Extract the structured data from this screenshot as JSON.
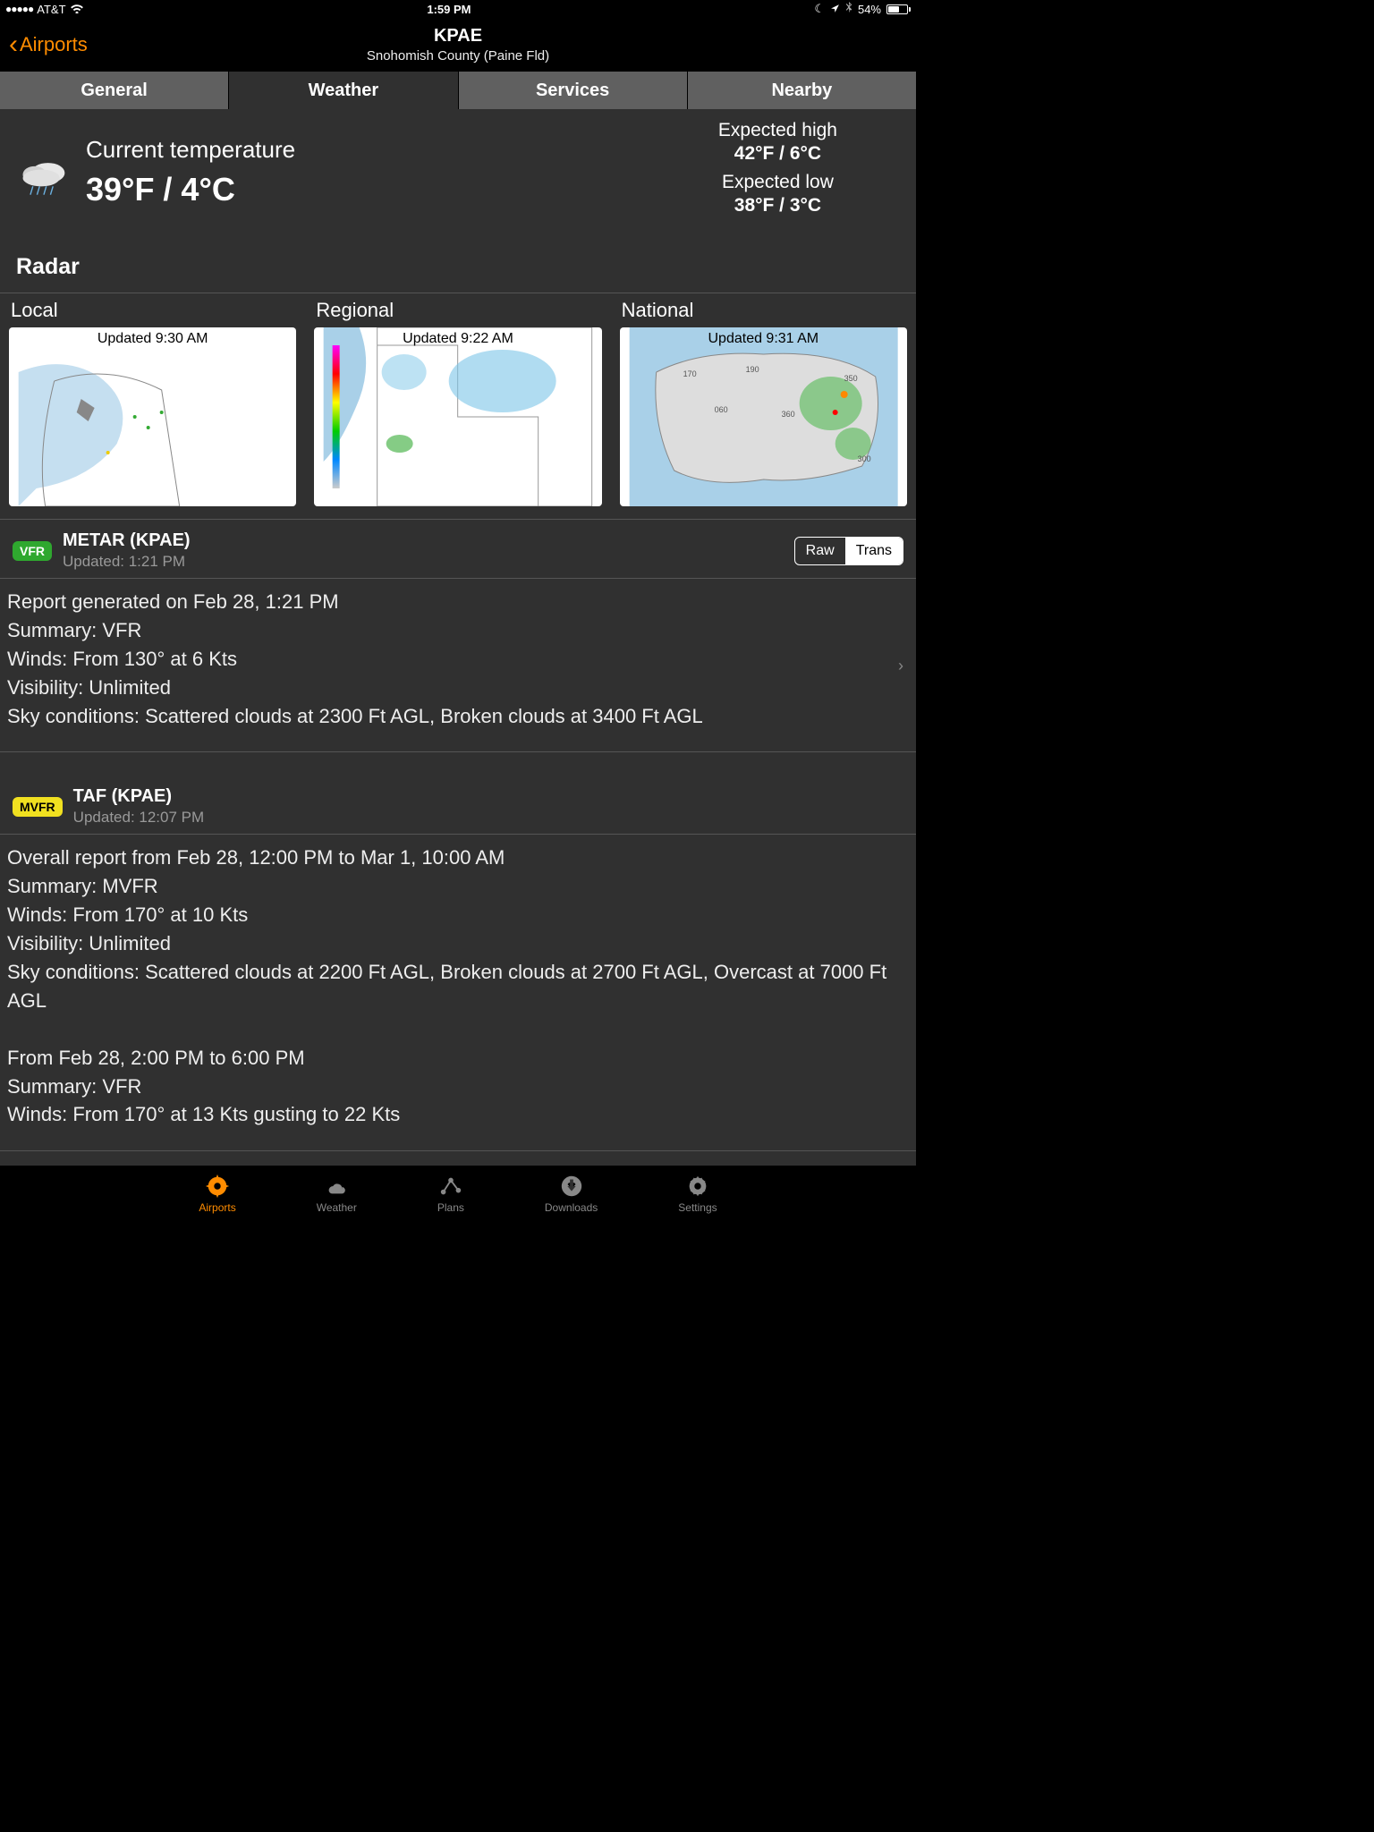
{
  "status_bar": {
    "carrier": "AT&T",
    "time": "1:59 PM",
    "battery_pct": "54%"
  },
  "nav": {
    "back_label": "Airports",
    "title": "KPAE",
    "subtitle": "Snohomish County (Paine Fld)"
  },
  "tabs": [
    "General",
    "Weather",
    "Services",
    "Nearby"
  ],
  "temperature": {
    "label": "Current temperature",
    "value": "39°F / 4°C",
    "high_label": "Expected high",
    "high_value": "42°F / 6°C",
    "low_label": "Expected low",
    "low_value": "38°F / 3°C"
  },
  "radar": {
    "header": "Radar",
    "items": [
      {
        "title": "Local",
        "updated": "Updated 9:30 AM"
      },
      {
        "title": "Regional",
        "updated": "Updated 9:22 AM"
      },
      {
        "title": "National",
        "updated": "Updated 9:31 AM"
      }
    ]
  },
  "metar": {
    "badge": "VFR",
    "title": "METAR (KPAE)",
    "updated": "Updated: 1:21 PM",
    "seg": [
      "Raw",
      "Trans"
    ],
    "body": "Report generated on Feb 28, 1:21 PM\nSummary: VFR\nWinds: From 130° at 6 Kts\nVisibility: Unlimited\nSky conditions: Scattered clouds at 2300 Ft AGL, Broken clouds at 3400 Ft AGL"
  },
  "taf": {
    "badge": "MVFR",
    "title": "TAF (KPAE)",
    "updated": "Updated: 12:07 PM",
    "body": "Overall report from Feb 28, 12:00 PM to Mar 1, 10:00 AM\nSummary: MVFR\nWinds: From 170° at 10 Kts\nVisibility: Unlimited\nSky conditions: Scattered clouds at 2200 Ft AGL, Broken clouds at 2700 Ft AGL, Overcast at 7000 Ft AGL\n\nFrom Feb 28, 2:00 PM to 6:00 PM\nSummary: VFR\nWinds: From 170° at 13 Kts gusting to 22 Kts"
  },
  "bottom_tabs": [
    "Airports",
    "Weather",
    "Plans",
    "Downloads",
    "Settings"
  ]
}
